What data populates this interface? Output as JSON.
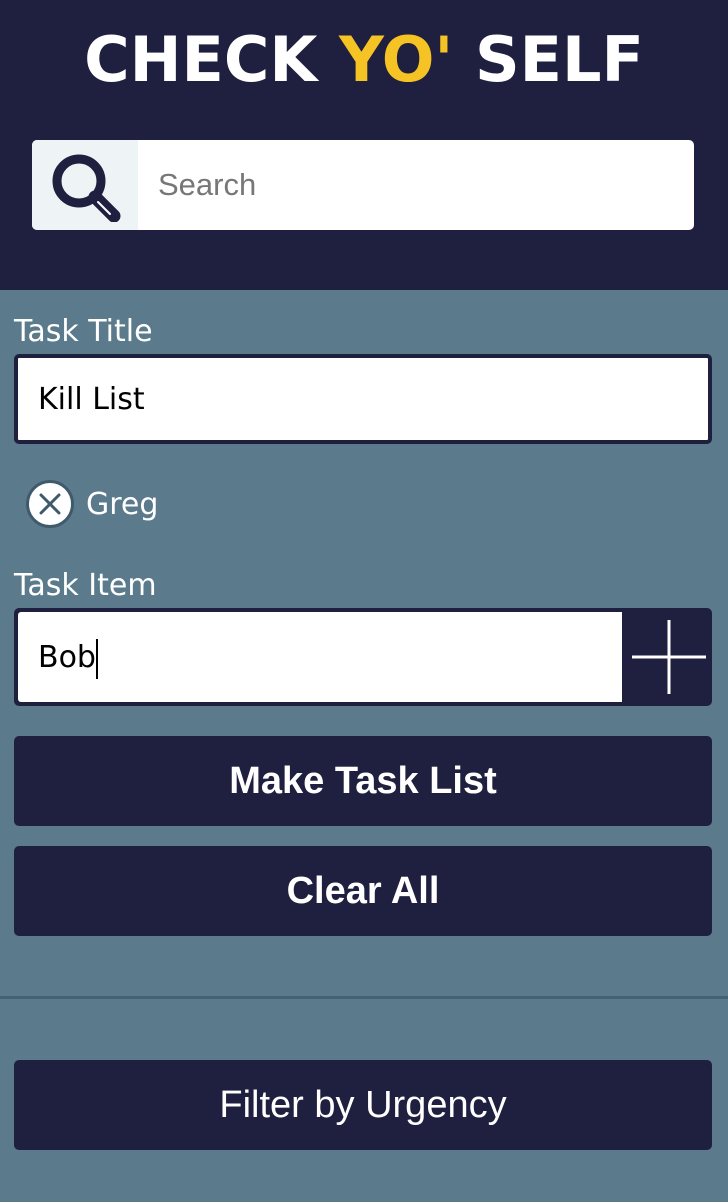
{
  "header": {
    "title_part1": "CHECK ",
    "title_accent": "YO'",
    "title_part2": " SELF",
    "accent_color": "#f6c324",
    "background_color": "#1f1f3f"
  },
  "search": {
    "placeholder": "Search",
    "value": "",
    "icon": "search-icon"
  },
  "form": {
    "task_title_label": "Task Title",
    "task_title_value": "Kill List",
    "pending_items": [
      {
        "text": "Greg",
        "icon": "remove-circle-icon"
      }
    ],
    "task_item_label": "Task Item",
    "task_item_value": "Bob",
    "add_icon": "plus-icon",
    "make_list_label": "Make Task List",
    "clear_all_label": "Clear All"
  },
  "filter": {
    "label": "Filter by Urgency"
  },
  "colors": {
    "page_background": "#5b7b8c",
    "button_background": "#1f1f3f"
  }
}
